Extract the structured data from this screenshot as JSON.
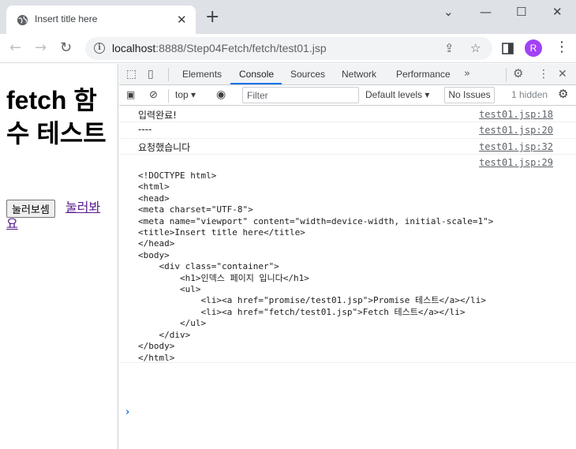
{
  "browser": {
    "tab_title": "Insert title here",
    "url_host": "localhost",
    "url_path": ":8888/Step04Fetch/fetch/test01.jsp",
    "profile_initial": "R"
  },
  "page": {
    "heading": "fetch 함수 테스트",
    "button_label": "눌러보셈",
    "link_text": "눌러봐요"
  },
  "devtools": {
    "tabs": [
      "Elements",
      "Console",
      "Sources",
      "Network",
      "Performance"
    ],
    "active_tab": "Console",
    "context": "top",
    "filter_placeholder": "Filter",
    "levels": "Default levels",
    "issues": "No Issues",
    "hidden": "1 hidden"
  },
  "console": {
    "logs": [
      {
        "msg": "입력완료!",
        "src": "test01.jsp:18"
      },
      {
        "msg": "----",
        "src": "test01.jsp:20"
      },
      {
        "msg": "요청했습니다",
        "src": "test01.jsp:32"
      },
      {
        "msg": "",
        "src": "test01.jsp:29"
      }
    ],
    "html_output": "<!DOCTYPE html>\n<html>\n<head>\n<meta charset=\"UTF-8\">\n<meta name=\"viewport\" content=\"width=device-width, initial-scale=1\">\n<title>Insert title here</title>\n</head>\n<body>\n    <div class=\"container\">\n        <h1>인덱스 페이지 입니다</h1>\n        <ul>\n            <li><a href=\"promise/test01.jsp\">Promise 테스트</a></li>\n            <li><a href=\"fetch/test01.jsp\">Fetch 테스트</a></li>\n        </ul>\n    </div>\n</body>\n</html>"
  }
}
